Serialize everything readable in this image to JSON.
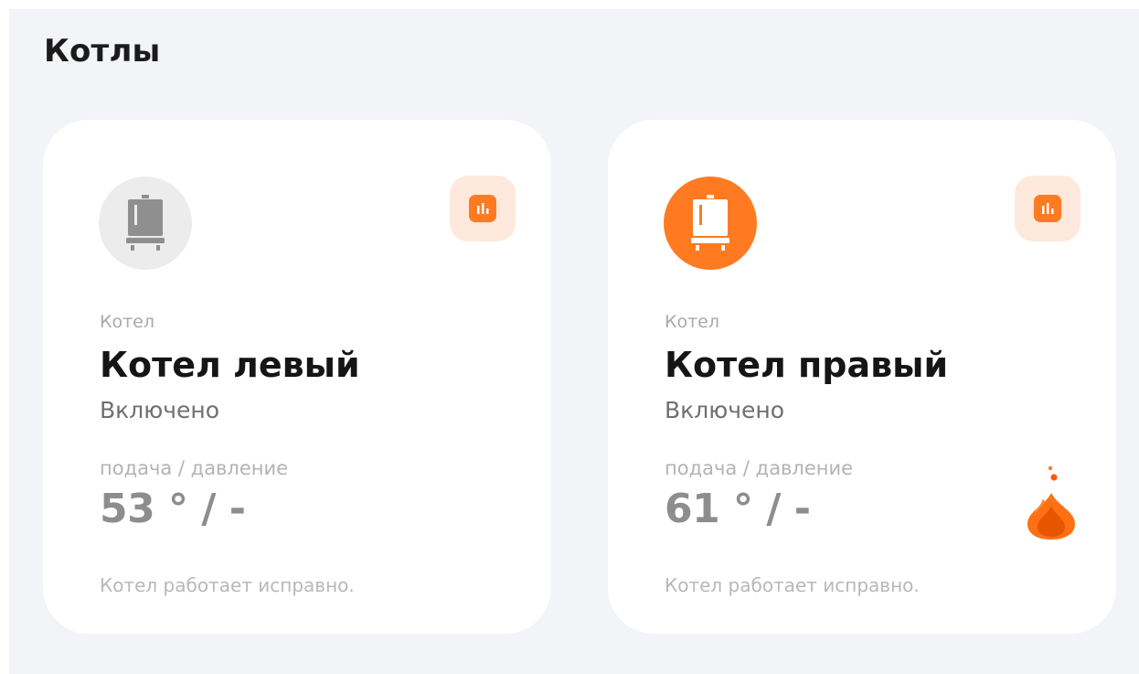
{
  "section": {
    "title": "Котлы"
  },
  "boilers": [
    {
      "type_label": "Котел",
      "name": "Котел левый",
      "status": "Включено",
      "metric_label": "подача / давление",
      "metric_value": "53 ° / -",
      "health": "Котел работает исправно.",
      "icon": "boiler-icon",
      "icon_state": "inactive",
      "flame_visible": false
    },
    {
      "type_label": "Котел",
      "name": "Котел правый",
      "status": "Включено",
      "metric_label": "подача / давление",
      "metric_value": "61 ° / -",
      "health": "Котел работает исправно.",
      "icon": "boiler-icon",
      "icon_state": "active",
      "flame_visible": true
    }
  ],
  "colors": {
    "accent": "#ff7a21",
    "accent_light": "#ffe9dc",
    "inactive_icon_bg": "#ececec",
    "panel_bg": "#f3f4f8"
  }
}
